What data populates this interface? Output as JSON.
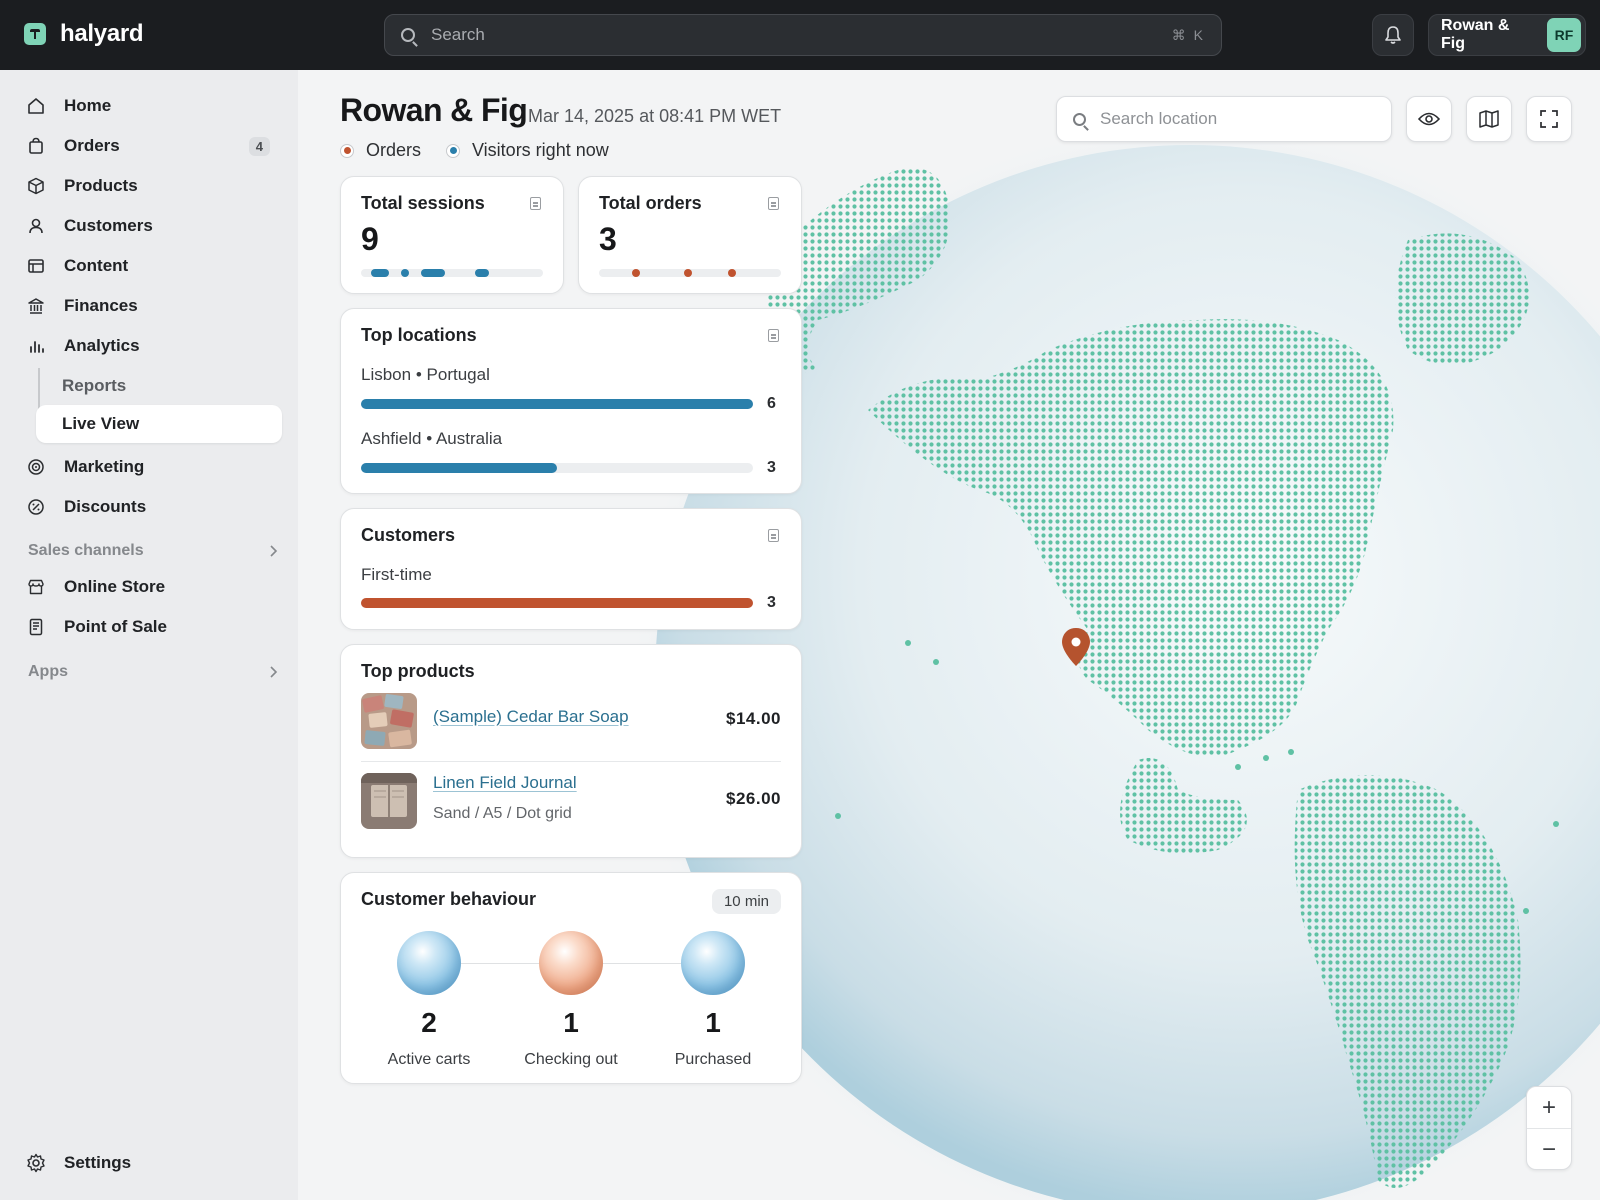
{
  "app": {
    "name": "halyard"
  },
  "topbar": {
    "search_placeholder": "Search",
    "shortcut": "⌘ K",
    "store_name": "Rowan & Fig",
    "avatar_initials": "RF"
  },
  "sidebar": {
    "items": [
      {
        "label": "Home",
        "icon": "home-icon"
      },
      {
        "label": "Orders",
        "icon": "bag-icon",
        "badge": "4"
      },
      {
        "label": "Products",
        "icon": "box-icon"
      },
      {
        "label": "Customers",
        "icon": "person-icon"
      },
      {
        "label": "Content",
        "icon": "content-icon"
      },
      {
        "label": "Finances",
        "icon": "bank-icon"
      },
      {
        "label": "Analytics",
        "icon": "bar-chart-icon"
      }
    ],
    "analytics_sub": [
      {
        "label": "Reports"
      },
      {
        "label": "Live View",
        "active": true
      }
    ],
    "items_after": [
      {
        "label": "Marketing",
        "icon": "target-icon"
      },
      {
        "label": "Discounts",
        "icon": "discount-icon"
      }
    ],
    "sales_channels_label": "Sales channels",
    "channels": [
      {
        "label": "Online Store",
        "icon": "store-icon"
      },
      {
        "label": "Point of Sale",
        "icon": "pos-icon"
      }
    ],
    "apps_label": "Apps",
    "settings_label": "Settings"
  },
  "header": {
    "title": "Rowan & Fig",
    "date": "Mar 14, 2025 at 08:41 PM WET",
    "legend": [
      {
        "label": "Orders",
        "color": "#c0532f"
      },
      {
        "label": "Visitors right now",
        "color": "#2a7fab"
      }
    ]
  },
  "map": {
    "search_placeholder": "Search location",
    "land_color": "#5fc1a4",
    "pin_color": "#b5532e",
    "zoom_in": "+",
    "zoom_out": "−"
  },
  "cards": {
    "sessions": {
      "title": "Total sessions",
      "value": "9",
      "color": "#2a7fab"
    },
    "orders": {
      "title": "Total orders",
      "value": "3",
      "color": "#c0532f"
    },
    "top_locations": {
      "title": "Top locations",
      "items": [
        {
          "city": "Lisbon",
          "country": "Portugal",
          "value": 6,
          "fraction": 1.0,
          "value_text": "6"
        },
        {
          "city": "Ashfield",
          "country": "Australia",
          "value": 3,
          "fraction": 0.5,
          "value_text": "3"
        }
      ],
      "separator": "•",
      "color": "#2a7fab"
    },
    "customers": {
      "title": "Customers",
      "items": [
        {
          "label": "First-time",
          "value": 3,
          "fraction": 1.0,
          "value_text": "3"
        }
      ],
      "color": "#c0532f"
    },
    "top_products": {
      "title": "Top products",
      "items": [
        {
          "name": "(Sample) Cedar Bar Soap",
          "variant": "",
          "price": "$14.00"
        },
        {
          "name": "Linen Field Journal",
          "variant": "Sand / A5 / Dot grid",
          "price": "$26.00"
        }
      ]
    },
    "behaviour": {
      "title": "Customer behaviour",
      "window": "10 min",
      "steps": [
        {
          "value": "2",
          "label": "Active carts"
        },
        {
          "value": "1",
          "label": "Checking out"
        },
        {
          "value": "1",
          "label": "Purchased"
        }
      ]
    }
  }
}
